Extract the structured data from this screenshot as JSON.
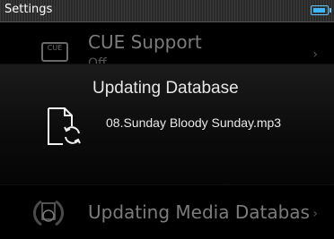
{
  "statusbar": {
    "title": "Settings",
    "battery_icon": "battery-icon"
  },
  "background_list": {
    "items": [
      {
        "label": "CUE Support",
        "sublabel": "Off",
        "icon": "cue-icon",
        "icon_text": "CUE"
      },
      {
        "label": "Updating Media Databas",
        "icon": "media-database-icon"
      }
    ],
    "chevron_icon": "chevron-right-icon"
  },
  "dialog": {
    "title": "Updating Database",
    "filename": "08.Sunday  Bloody Sunday.mp3",
    "icon": "document-refresh-icon"
  },
  "colors": {
    "background": "#000000",
    "accent": "#3fb7ff",
    "text_primary": "#e6e6e6",
    "text_dim": "#7c7c7c"
  }
}
